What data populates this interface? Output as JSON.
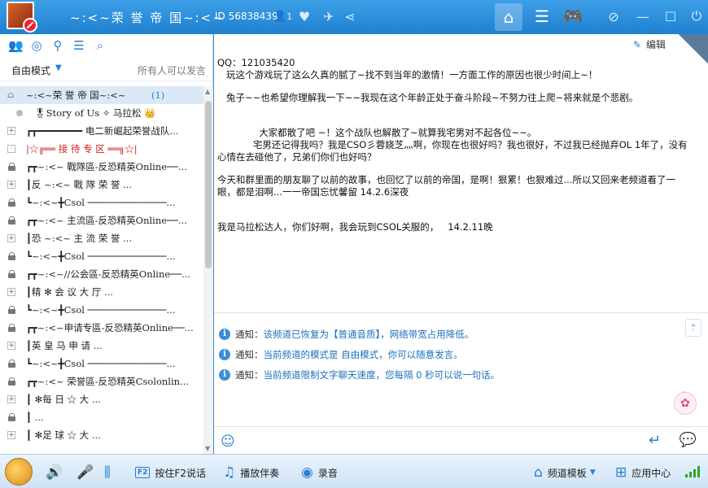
{
  "titlebar": {
    "channel_title": "~:<~荣 誉 帝 国~:<~",
    "channel_id": "ID 56838439",
    "user_count": "1"
  },
  "left": {
    "mode_label": "自由模式",
    "mode_hint": "所有人可以发言",
    "tree": [
      {
        "kind": "home",
        "label": "~:<~荣 誉 帝 国~:<~",
        "count": "(1)",
        "selected": true
      },
      {
        "kind": "member",
        "label": "🎖Story of Us ✧ 马拉松 👑"
      },
      {
        "kind": "plus",
        "label": "┏┳━━━━━━━━ 电二新崛起荣誉战队..."
      },
      {
        "kind": "dot",
        "label": "|☆╔══ 接 待 专 区 ══╗☆|",
        "red": true
      },
      {
        "kind": "lock",
        "label": "┏┳~:<~ 戰隊區-反恐精英Online──..."
      },
      {
        "kind": "plus",
        "label": "┃反   ~:<~ 戰 隊 荣 誉 ..."
      },
      {
        "kind": "lock",
        "label": "┗~:<~╋Csol ──────────────..."
      },
      {
        "kind": "lock",
        "label": "┏┳~:<~ 主流區-反恐精英Online──..."
      },
      {
        "kind": "plus",
        "label": "┃恐   ~:<~ 主 流 荣 誉 ..."
      },
      {
        "kind": "lock",
        "label": "┗~:<~╋Csol ──────────────..."
      },
      {
        "kind": "lock",
        "label": "┏┳~:<~//公会區-反恐精英Online──..."
      },
      {
        "kind": "dotplus",
        "label": "┃精    ✻    会 议 大 厅 ..."
      },
      {
        "kind": "lock",
        "label": "┗~:<~╋Csol ──────────────..."
      },
      {
        "kind": "lock",
        "label": "┏┳~:<~申请专區-反恐精英Online──..."
      },
      {
        "kind": "plus",
        "label": "┃英    皇  马  申  请  ..."
      },
      {
        "kind": "lock",
        "label": "┗~:<~╋Csol ──────────────..."
      },
      {
        "kind": "lock",
        "label": "┏┳~:<~ 荣誉區-反恐精英Csolonlin..."
      },
      {
        "kind": "plus",
        "label": "┃       ✻每  日 ☆ 大  ..."
      },
      {
        "kind": "lock",
        "label": "┃                       ..."
      },
      {
        "kind": "plus",
        "label": "┃       ✻足  球 ☆ 大  ..."
      }
    ]
  },
  "chat": {
    "edit_label": "编辑",
    "messages": [
      {
        "lines": [
          "QQ：121035420",
          "   玩这个游戏玩了这么久真的腻了~找不到当年的激情！一方面工作的原因也很少时间上~！"
        ]
      },
      {
        "lines": [
          "   兔子~~也希望你理解我一下~~我现在这个年龄正处于奋斗阶段~不努力往上爬~将来就是个悲剧。"
        ]
      },
      {
        "lines": [
          "",
          "              大家都散了吧 ~！这个战队也解散了~就算我宅男对不起各位~~。",
          "            宅男还记得我吗？我是CSO彡蓉娆芝灬啊，你现在也很好吗？我也很好，不过我已经抛弃OL 1年了，没有",
          "心情在去碰他了，兄弟们你们也好吗？"
        ]
      },
      {
        "lines": [
          "今天和群里面的朋友聊了以前的故事，也回忆了以前的帝国，是啊！狠累！也狠难过...所以又回来老频道看了一",
          "眼，都是泪啊...一一帝国忘忧馨留 14.2.6深夜"
        ]
      },
      {
        "lines": [
          "",
          "我是马拉松达人，你们好啊，我会玩到CSOL关服的，   14.2.11晚"
        ]
      }
    ],
    "notices": [
      {
        "tag": "通知：",
        "text": "该频道已恢复为【普通音质】，网络带宽占用降低。"
      },
      {
        "tag": "通知：",
        "text": "当前频道的模式是 自由模式，你可以随意发言。"
      },
      {
        "tag": "通知：",
        "text": "当前频道限制文字聊天速度，您每隔 0 秒可以说一句话。"
      }
    ]
  },
  "bottombar": {
    "f2_badge": "F2",
    "push_to_talk": "按住F2说话",
    "play_accompaniment": "播放伴奏",
    "record": "录音",
    "channel_template": "频道模板",
    "app_center": "应用中心"
  },
  "colors": {
    "accent": "#2a7ed0",
    "titlebar": "#1f80cf",
    "notice_text": "#1a6fbf",
    "red_label": "#d21b1b"
  }
}
